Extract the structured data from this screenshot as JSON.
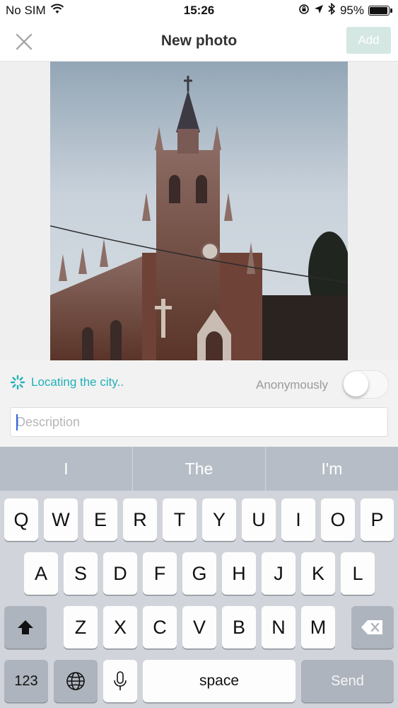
{
  "status_bar": {
    "carrier": "No SIM",
    "time": "15:26",
    "battery_percent": "95%",
    "battery_level": 0.95
  },
  "nav": {
    "title": "New photo",
    "add_label": "Add"
  },
  "meta": {
    "locating_text": "Locating the city..",
    "anonymous_label": "Anonymously",
    "anonymous_on": false,
    "description_placeholder": "Description",
    "description_value": ""
  },
  "keyboard": {
    "suggestions": [
      "I",
      "The",
      "I'm"
    ],
    "row1": [
      "Q",
      "W",
      "E",
      "R",
      "T",
      "Y",
      "U",
      "I",
      "O",
      "P"
    ],
    "row2": [
      "A",
      "S",
      "D",
      "F",
      "G",
      "H",
      "J",
      "K",
      "L"
    ],
    "row3": [
      "Z",
      "X",
      "C",
      "V",
      "B",
      "N",
      "M"
    ],
    "numbers_label": "123",
    "space_label": "space",
    "send_label": "Send"
  },
  "icons": {
    "close": "close-icon",
    "wifi": "wifi-icon",
    "bluetooth": "bluetooth-icon",
    "location": "location-arrow-icon",
    "lock_rotation": "rotation-lock-icon",
    "spinner": "spinner-icon",
    "shift": "shift-icon",
    "delete": "delete-icon",
    "globe": "globe-icon",
    "mic": "microphone-icon"
  },
  "colors": {
    "accent": "#21b0b8",
    "add_button_bg": "#d4e7e3",
    "keyboard_bg": "#d1d5db"
  }
}
